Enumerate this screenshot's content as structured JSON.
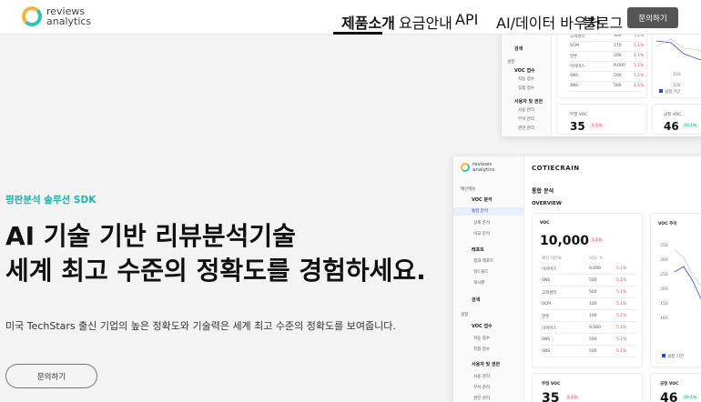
{
  "brand": {
    "line1": "reviews",
    "line2": "analytics"
  },
  "nav": {
    "items": [
      "제품소개",
      "요금안내",
      "API",
      "AI/데이터 바우처",
      "블로그"
    ],
    "contact": "문의하기"
  },
  "hero": {
    "eyebrow": "평판분석 솔루션 SDK",
    "headline1": "AI 기술 기반 리뷰분석기술",
    "headline2": "세계 최고 수준의 정확도를 경험하세요.",
    "sub": "미국 TechStars 출신 기업의 높은 정확도와 기술력은 세계 최고 수준의 정확도를 보여줍니다.",
    "button": "문의하기"
  },
  "dashboard": {
    "company": "COTIECRAIN",
    "section": "통합 분석",
    "overview": "OVERVIEW",
    "voc_title": "VOC",
    "voc_total": "10,000",
    "voc_pct": "5.1%",
    "voc_trend_title": "VOC 추이",
    "neg_title": "부정 VOC",
    "neg_value": "35",
    "neg_pct": "5.1%",
    "pos_title": "긍정 VOC",
    "pos_value": "46",
    "pos_pct": "10.1%",
    "col_channel": "채널 대분류",
    "col_voc": "VOC 수",
    "rows": [
      {
        "name": "이커머스",
        "value": "9,000",
        "pct": "5.1%"
      },
      {
        "name": "SNS",
        "value": "500",
        "pct": "5.1%"
      },
      {
        "name": "고객센터",
        "value": "500",
        "pct": "5.1%"
      },
      {
        "name": "SCM",
        "value": "100",
        "pct": "5.1%"
      },
      {
        "name": "언론",
        "value": "100",
        "pct": "5.1%"
      },
      {
        "name": "이커머스",
        "value": "9,000",
        "pct": "5.1%"
      },
      {
        "name": "SNS",
        "value": "500",
        "pct": "5.1%"
      },
      {
        "name": "SNS",
        "value": "500",
        "pct": "5.1%"
      }
    ],
    "y_ticks": [
      "350",
      "300",
      "250",
      "200",
      "150",
      "100"
    ],
    "legend_prev": "설정 기간",
    "side": {
      "menu_label": "메인메뉴",
      "voc_analysis": "VOC 분석",
      "integrated": "통합 분석",
      "detail": "상세 분석",
      "compare": "비교 분석",
      "report": "레포트",
      "report_sub1": "결과 레포트",
      "report_sub2": "워드클드",
      "report_sub3": "게시판",
      "search": "검색",
      "settings_label": "설정",
      "voc_collect": "VOC 접수",
      "collect_sub1": "자동 접수",
      "collect_sub2": "직접 접수",
      "users": "사용자 및 권한",
      "users_sub1": "사용 관리",
      "users_sub2": "부서 관리",
      "users_sub3": "권한 관리"
    },
    "top_rows": [
      {
        "name": "고객센터",
        "value": "300",
        "pct": "5.1%"
      },
      {
        "name": "SCM",
        "value": "170",
        "pct": "5.1%"
      },
      {
        "name": "언론",
        "value": "100",
        "pct": "4.1%"
      },
      {
        "name": "이커머스",
        "value": "9,000",
        "pct": "5.1%"
      },
      {
        "name": "SNS",
        "value": "500",
        "pct": "5.1%"
      },
      {
        "name": "SNS",
        "value": "500",
        "pct": "4.1%"
      }
    ],
    "top_ticks": [
      "150",
      "100"
    ],
    "top_side": {
      "search": "검색",
      "settings": "설정",
      "voc_collect": "VOC 접수",
      "collect_sub1": "자동 접수",
      "collect_sub2": "직접 접수",
      "users": "사용자 및 권한",
      "users_sub1": "사용 관리",
      "users_sub2": "부서 관리",
      "users_sub3": "권한 관리"
    }
  },
  "colors": {
    "accent": "#18b5b0",
    "primary_dark": "#555555",
    "negative": "#e2475b",
    "positive": "#14a37f"
  }
}
